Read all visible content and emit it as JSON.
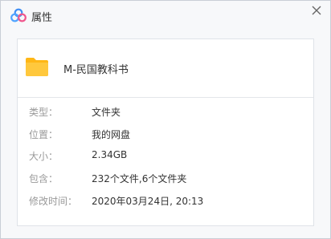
{
  "window": {
    "title": "属性"
  },
  "file": {
    "name": "M-民国教科书",
    "icon": "folder-icon"
  },
  "properties": [
    {
      "label": "类型：",
      "value": "文件夹"
    },
    {
      "label": "位置：",
      "value": "我的网盘"
    },
    {
      "label": "大小：",
      "value": "2.34GB"
    },
    {
      "label": "包含：",
      "value": "232个文件,6个文件夹"
    },
    {
      "label": "修改时间：",
      "value": "2020年03月24日, 20:13"
    }
  ],
  "colors": {
    "logo_blue": "#3f8ef5",
    "logo_pink": "#f0568c",
    "folder_yellow": "#ffc83d",
    "label_gray": "#999999",
    "text_dark": "#333333"
  }
}
